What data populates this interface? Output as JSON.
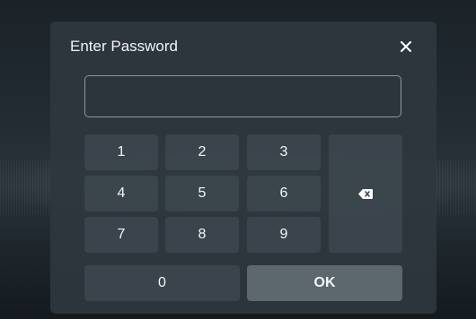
{
  "dialog": {
    "title": "Enter Password",
    "close_icon": "close-icon",
    "password": {
      "value": "",
      "placeholder": ""
    }
  },
  "keypad": {
    "keys": [
      "1",
      "2",
      "3",
      "4",
      "5",
      "6",
      "7",
      "8",
      "9"
    ],
    "zero": "0",
    "ok": "OK",
    "backspace_icon": "backspace-icon"
  },
  "colors": {
    "dialog_bg": "#2e373e",
    "key_bg": "#3e484f",
    "ok_bg": "#5c676e",
    "text": "#f2f4f5"
  }
}
